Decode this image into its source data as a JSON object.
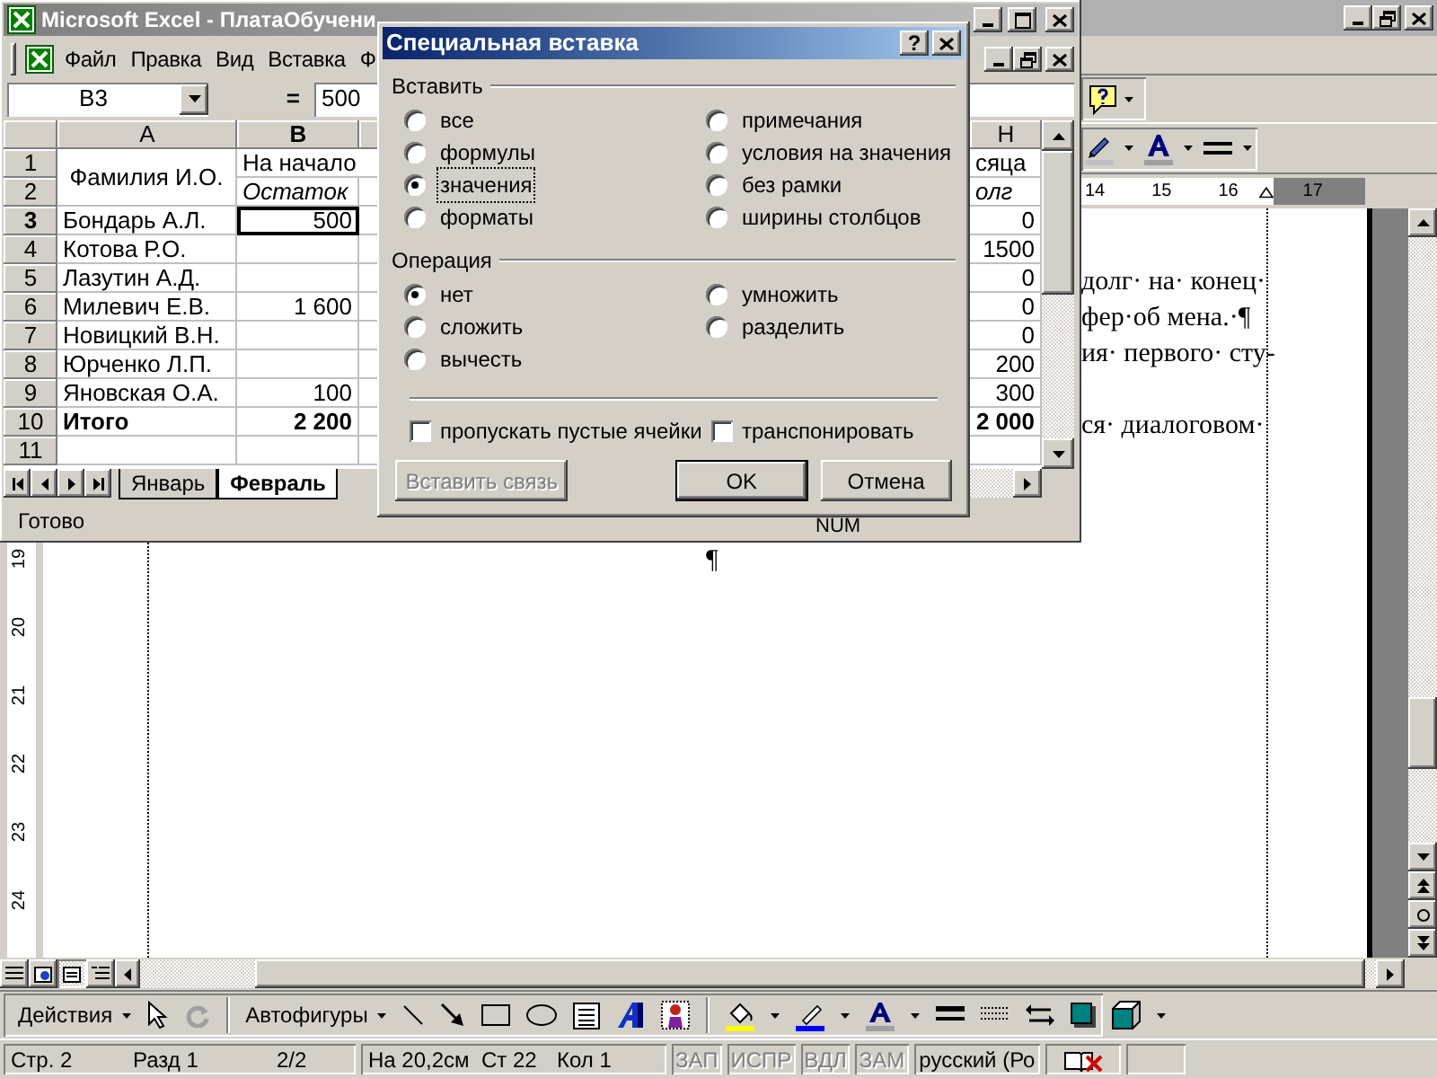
{
  "word": {
    "ruler_labels": [
      "14",
      "15",
      "16",
      "17"
    ],
    "vertical_ruler_labels": [
      "19",
      "20",
      "21",
      "22",
      "23",
      "24"
    ],
    "document_text": {
      "upper_lines": [
        "долг· на· конец·",
        "фер·об мена.·¶",
        "ия· первого· сту-"
      ],
      "lower_line": "ся· диалоговом·"
    },
    "pilcrow": "¶",
    "drawing_toolbar": {
      "actions": "Действия",
      "autoshapes": "Автофигуры"
    },
    "status_bar": {
      "position": [
        "Стр. 2",
        "Разд 1",
        "2/2"
      ],
      "cursor": [
        "На 20,2см",
        "Ст 22",
        "Кол 1"
      ],
      "modes": [
        {
          "label": "ЗАП",
          "disabled": true
        },
        {
          "label": "ИСПР",
          "disabled": true
        },
        {
          "label": "ВДЛ",
          "disabled": true
        },
        {
          "label": "ЗАМ",
          "disabled": true
        }
      ],
      "language": "русский (Ро"
    }
  },
  "excel": {
    "title": "Microsoft Excel - ПлатаОбучени",
    "menu": [
      "Файл",
      "Правка",
      "Вид",
      "Вставка",
      "Ф"
    ],
    "name_box": "B3",
    "formula_equals": "=",
    "formula_value": "500",
    "columns": [
      {
        "label": "A",
        "selected": false
      },
      {
        "label": "B",
        "selected": true
      },
      {
        "label": "H",
        "selected": false
      }
    ],
    "rows": [
      {
        "header": "1",
        "selected": false,
        "kind": "heading",
        "a_merged_down": true,
        "a": "Фамилия И.О.",
        "b": "На начало",
        "h": "сяца"
      },
      {
        "header": "2",
        "selected": false,
        "kind": "subheading",
        "b": "Остаток",
        "h": "олг"
      },
      {
        "header": "3",
        "selected": true,
        "kind": "data",
        "a_merged_down": false,
        "a": "Бондарь А.Л.",
        "b": "500",
        "h": "0"
      },
      {
        "header": "4",
        "selected": false,
        "kind": "data",
        "a_merged_down": false,
        "a": "Котова Р.О.",
        "h": "1500"
      },
      {
        "header": "5",
        "selected": false,
        "kind": "data",
        "a_merged_down": false,
        "a": "Лазутин А.Д.",
        "h": "0"
      },
      {
        "header": "6",
        "selected": false,
        "kind": "data",
        "a_merged_down": false,
        "a": "Милевич Е.В.",
        "b": "1 600",
        "h": "0"
      },
      {
        "header": "7",
        "selected": false,
        "kind": "data",
        "a_merged_down": false,
        "a": "Новицкий В.Н.",
        "h": "0"
      },
      {
        "header": "8",
        "selected": false,
        "kind": "data",
        "a_merged_down": false,
        "a": "Юрченко Л.П.",
        "h": "200"
      },
      {
        "header": "9",
        "selected": false,
        "kind": "data",
        "a_merged_down": false,
        "a": "Яновская О.А.",
        "b": "100",
        "h": "300"
      },
      {
        "header": "10",
        "selected": false,
        "kind": "total",
        "a_merged_down": false,
        "a": "Итого",
        "b": "2 200",
        "h": "2 000"
      },
      {
        "header": "11",
        "selected": false,
        "kind": "data",
        "a_merged_down": false
      }
    ],
    "sheet_tabs": [
      {
        "label": "Январь",
        "selected": false
      },
      {
        "label": "Февраль",
        "selected": true
      }
    ],
    "status": "Готово",
    "indicator": "NUM"
  },
  "dialog": {
    "title": "Специальная вставка",
    "help_button": "?",
    "paste_label": "Вставить",
    "paste_options": [
      {
        "label": "все",
        "selected": false,
        "focused": false
      },
      {
        "label": "формулы",
        "selected": false,
        "focused": false
      },
      {
        "label": "значения",
        "selected": true,
        "focused": true
      },
      {
        "label": "форматы",
        "selected": false,
        "focused": false
      },
      {
        "label": "примечания",
        "selected": false,
        "focused": false
      },
      {
        "label": "условия на значения",
        "selected": false,
        "focused": false
      },
      {
        "label": "без рамки",
        "selected": false,
        "focused": false
      },
      {
        "label": "ширины столбцов",
        "selected": false,
        "focused": false
      }
    ],
    "operation_label": "Операция",
    "operations": [
      {
        "label": "нет",
        "selected": true
      },
      {
        "label": "сложить",
        "selected": false
      },
      {
        "label": "вычесть",
        "selected": false
      },
      {
        "label": "умножить",
        "selected": false
      },
      {
        "label": "разделить",
        "selected": false
      }
    ],
    "checkboxes": [
      {
        "label": "пропускать пустые ячейки",
        "checked": false
      },
      {
        "label": "транспонировать",
        "checked": false
      }
    ],
    "buttons": [
      {
        "label": "Вставить связь",
        "disabled": true,
        "default": false
      },
      {
        "label": "OK",
        "disabled": false,
        "default": true
      },
      {
        "label": "Отмена",
        "disabled": false,
        "default": false
      }
    ]
  }
}
